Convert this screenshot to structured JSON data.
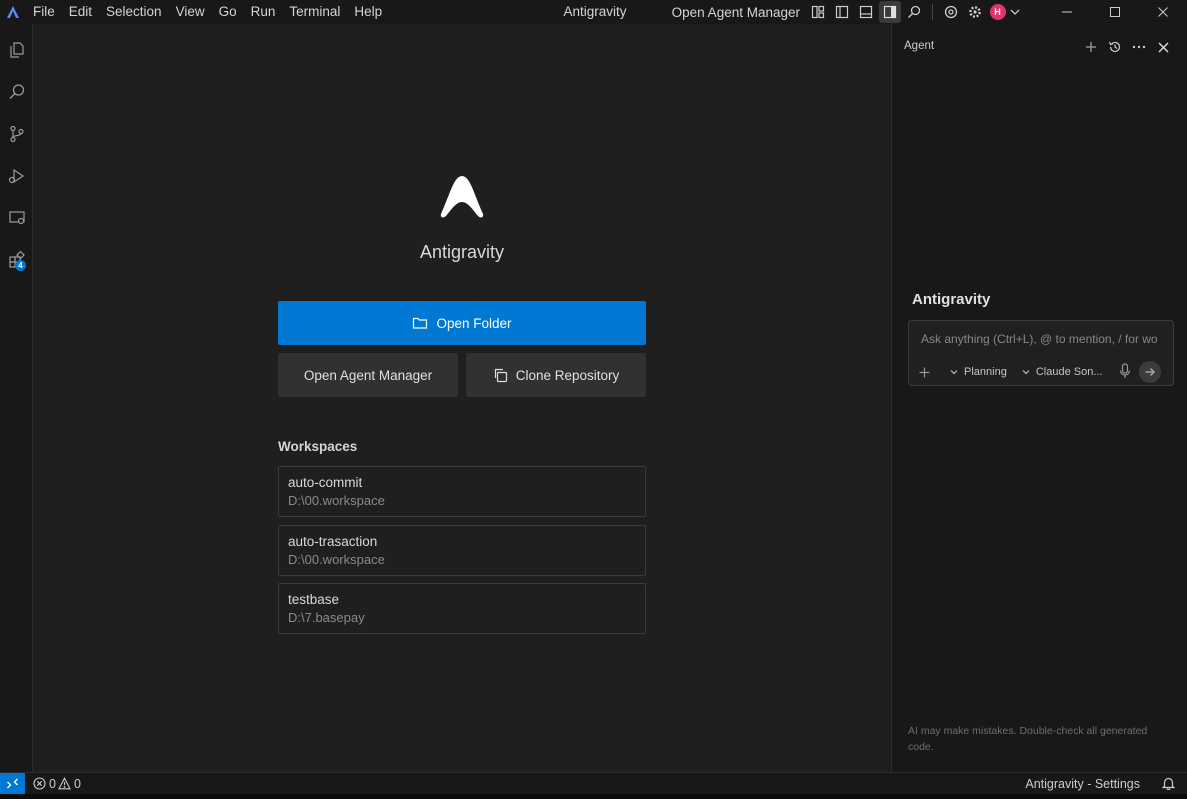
{
  "titlebar": {
    "menu": [
      "File",
      "Edit",
      "Selection",
      "View",
      "Go",
      "Run",
      "Terminal",
      "Help"
    ],
    "window_title": "Antigravity",
    "agent_manager_link": "Open Agent Manager",
    "avatar_initial": "H"
  },
  "activity_badge": "4",
  "editor": {
    "app_name": "Antigravity",
    "open_folder": "Open Folder",
    "open_agent_manager": "Open Agent Manager",
    "clone_repository": "Clone Repository",
    "workspaces_heading": "Workspaces",
    "workspaces": [
      {
        "name": "auto-commit",
        "path": "D:\\00.workspace"
      },
      {
        "name": "auto-trasaction",
        "path": "D:\\00.workspace"
      },
      {
        "name": "testbase",
        "path": "D:\\7.basepay"
      }
    ]
  },
  "agent": {
    "title": "Agent",
    "heading": "Antigravity",
    "placeholder": "Ask anything (Ctrl+L), @ to mention, / for wo",
    "mode": "Planning",
    "model": "Claude Son...",
    "disclaimer": "AI may make mistakes. Double-check all generated code."
  },
  "statusbar": {
    "errors": "0",
    "warnings": "0",
    "settings_label": "Antigravity - Settings"
  },
  "colors": {
    "accent": "#0078d4",
    "background": "#1f1f1f",
    "sidebar": "#181818"
  }
}
